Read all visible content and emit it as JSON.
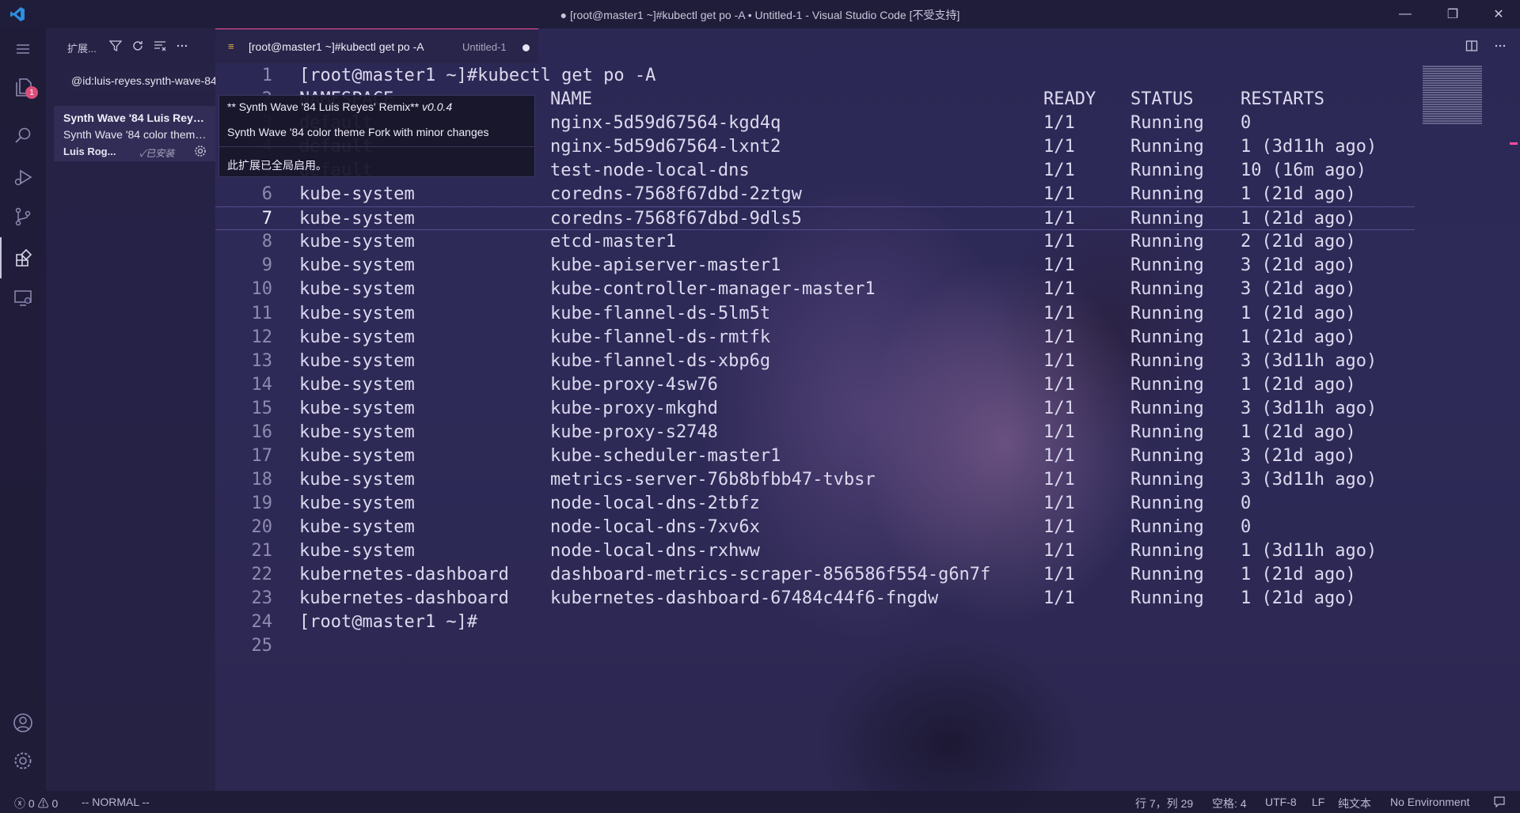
{
  "window": {
    "title": "● [root@master1 ~]#kubectl get po -A • Untitled-1 - Visual Studio Code [不受支持]",
    "minimize_glyph": "—",
    "restore_glyph": "❐",
    "close_glyph": "✕"
  },
  "activity": {
    "explorer_badge": "1"
  },
  "sidebar": {
    "title": "扩展...",
    "search_value": "@id:luis-reyes.synth-wave-84",
    "extension": {
      "name": "Synth Wave '84 Luis Reyes' Remix",
      "description": "Synth Wave '84 color theme Fork with minor changes",
      "author": "Luis Rog...",
      "installed": "✓已安装"
    }
  },
  "hover": {
    "title": "** Synth Wave '84 Luis Reyes' Remix**",
    "version": "v0.0.4",
    "description": "Synth Wave '84 color theme Fork with minor changes",
    "status": "此扩展已全局启用。"
  },
  "tab": {
    "label": "[root@master1 ~]#kubectl get po -A",
    "description": "Untitled-1"
  },
  "editor": {
    "current_line": 7,
    "lines": [
      {
        "n": "1",
        "text": "[root@master1 ~]#kubectl get po -A"
      },
      {
        "n": "2",
        "cols": [
          "NAMESPACE",
          "NAME",
          "READY",
          "STATUS",
          "RESTARTS"
        ]
      },
      {
        "n": "3",
        "cols": [
          "default",
          "nginx-5d59d67564-kgd4q",
          "1/1",
          "Running",
          "0"
        ]
      },
      {
        "n": "4",
        "cols": [
          "default",
          "nginx-5d59d67564-lxnt2",
          "1/1",
          "Running",
          "1 (3d11h ago)"
        ]
      },
      {
        "n": "5",
        "cols": [
          "default",
          "test-node-local-dns",
          "1/1",
          "Running",
          "10 (16m ago)"
        ]
      },
      {
        "n": "6",
        "cols": [
          "kube-system",
          "coredns-7568f67dbd-2ztgw",
          "1/1",
          "Running",
          "1 (21d ago)"
        ]
      },
      {
        "n": "7",
        "cols": [
          "kube-system",
          "coredns-7568f67dbd-9dls5",
          "1/1",
          "Running",
          "1 (21d ago)"
        ]
      },
      {
        "n": "8",
        "cols": [
          "kube-system",
          "etcd-master1",
          "1/1",
          "Running",
          "2 (21d ago)"
        ]
      },
      {
        "n": "9",
        "cols": [
          "kube-system",
          "kube-apiserver-master1",
          "1/1",
          "Running",
          "3 (21d ago)"
        ]
      },
      {
        "n": "10",
        "cols": [
          "kube-system",
          "kube-controller-manager-master1",
          "1/1",
          "Running",
          "3 (21d ago)"
        ]
      },
      {
        "n": "11",
        "cols": [
          "kube-system",
          "kube-flannel-ds-5lm5t",
          "1/1",
          "Running",
          "1 (21d ago)"
        ]
      },
      {
        "n": "12",
        "cols": [
          "kube-system",
          "kube-flannel-ds-rmtfk",
          "1/1",
          "Running",
          "1 (21d ago)"
        ]
      },
      {
        "n": "13",
        "cols": [
          "kube-system",
          "kube-flannel-ds-xbp6g",
          "1/1",
          "Running",
          "3 (3d11h ago)"
        ]
      },
      {
        "n": "14",
        "cols": [
          "kube-system",
          "kube-proxy-4sw76",
          "1/1",
          "Running",
          "1 (21d ago)"
        ]
      },
      {
        "n": "15",
        "cols": [
          "kube-system",
          "kube-proxy-mkghd",
          "1/1",
          "Running",
          "3 (3d11h ago)"
        ]
      },
      {
        "n": "16",
        "cols": [
          "kube-system",
          "kube-proxy-s2748",
          "1/1",
          "Running",
          "1 (21d ago)"
        ]
      },
      {
        "n": "17",
        "cols": [
          "kube-system",
          "kube-scheduler-master1",
          "1/1",
          "Running",
          "3 (21d ago)"
        ]
      },
      {
        "n": "18",
        "cols": [
          "kube-system",
          "metrics-server-76b8bfbb47-tvbsr",
          "1/1",
          "Running",
          "3 (3d11h ago)"
        ]
      },
      {
        "n": "19",
        "cols": [
          "kube-system",
          "node-local-dns-2tbfz",
          "1/1",
          "Running",
          "0"
        ]
      },
      {
        "n": "20",
        "cols": [
          "kube-system",
          "node-local-dns-7xv6x",
          "1/1",
          "Running",
          "0"
        ]
      },
      {
        "n": "21",
        "cols": [
          "kube-system",
          "node-local-dns-rxhww",
          "1/1",
          "Running",
          "1 (3d11h ago)"
        ]
      },
      {
        "n": "22",
        "cols": [
          "kubernetes-dashboard",
          "dashboard-metrics-scraper-856586f554-g6n7f",
          "1/1",
          "Running",
          "1 (21d ago)"
        ]
      },
      {
        "n": "23",
        "cols": [
          "kubernetes-dashboard",
          "kubernetes-dashboard-67484c44f6-fngdw",
          "1/1",
          "Running",
          "1 (21d ago)"
        ]
      },
      {
        "n": "24",
        "text": "[root@master1 ~]#"
      },
      {
        "n": "25",
        "text": ""
      }
    ]
  },
  "statusbar": {
    "errors": "0",
    "warnings": "0",
    "mode": "-- NORMAL --",
    "position": "行 7，列 29",
    "indent": "空格: 4",
    "encoding": "UTF-8",
    "eol": "LF",
    "language": "纯文本",
    "environment": "No Environment"
  },
  "colors": {
    "accent": "#ff4fa0",
    "badge": "#d94f7a",
    "background": "#2a2550"
  },
  "icons": [
    "vscode-logo-icon",
    "menu-icon",
    "files-icon",
    "search-icon",
    "run-debug-icon",
    "source-control-icon",
    "extensions-icon",
    "remote-explorer-icon",
    "account-icon",
    "settings-gear-icon",
    "filter-icon",
    "refresh-icon",
    "clear-icon",
    "more-icon",
    "split-editor-icon",
    "error-icon",
    "warning-icon",
    "feedback-icon"
  ]
}
